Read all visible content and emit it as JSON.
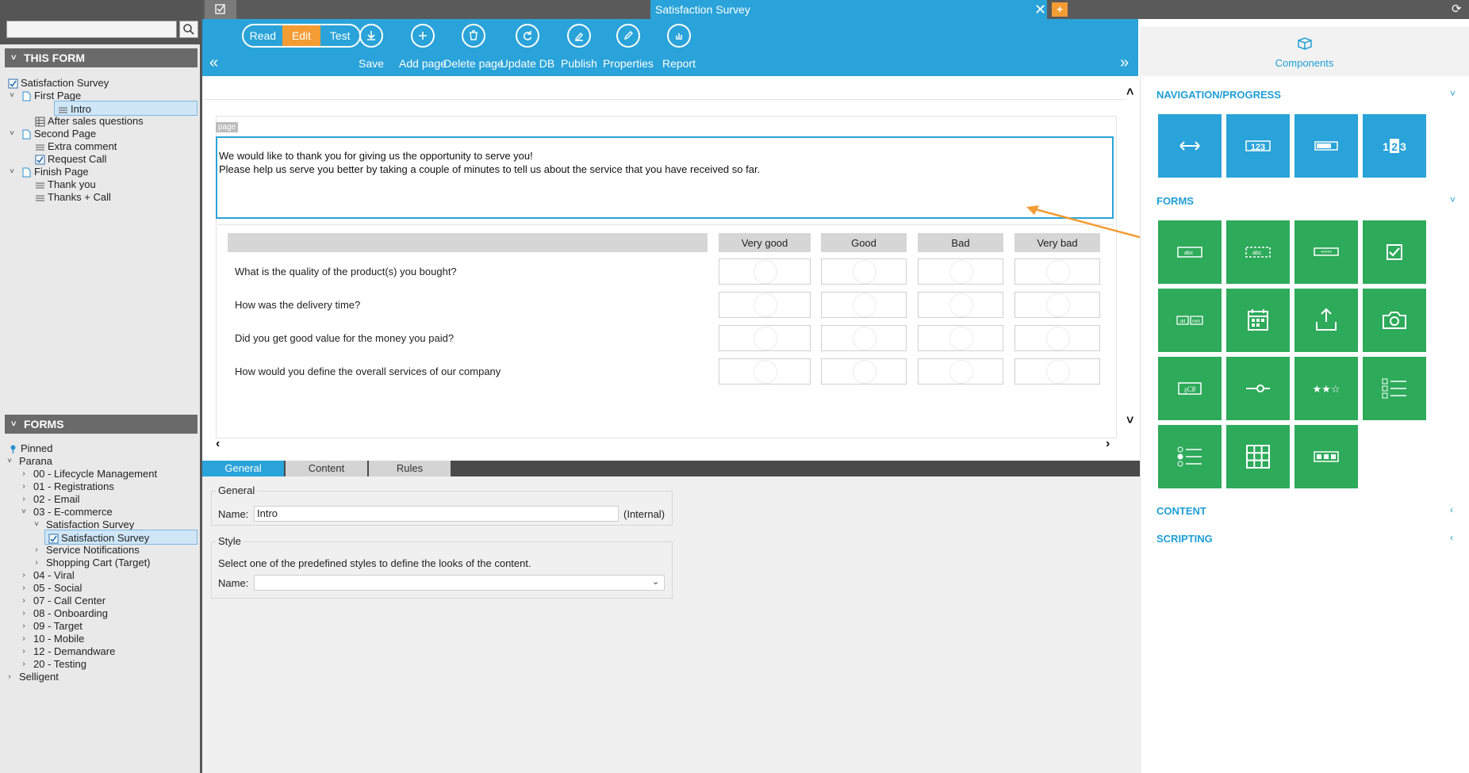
{
  "tabs": {
    "main_title": "Satisfaction Survey",
    "close_glyph": "✕",
    "add_glyph": "+"
  },
  "left": {
    "this_form_header": "THIS FORM",
    "this_form_tree": [
      {
        "label": "Satisfaction Survey",
        "icon": "check-icon"
      },
      {
        "label": "First Page",
        "icon": "page-icon"
      },
      {
        "label": "Intro",
        "icon": "lines-icon"
      },
      {
        "label": "After sales questions",
        "icon": "grid-icon"
      },
      {
        "label": "Second Page",
        "icon": "page-icon"
      },
      {
        "label": "Extra comment",
        "icon": "lines-icon"
      },
      {
        "label": "Request Call",
        "icon": "check-icon"
      },
      {
        "label": "Finish Page",
        "icon": "page-icon"
      },
      {
        "label": "Thank you",
        "icon": "lines-icon"
      },
      {
        "label": "Thanks + Call",
        "icon": "lines-icon"
      }
    ],
    "forms_header": "FORMS",
    "forms_tree": [
      {
        "label": "Pinned",
        "icon": "pin-icon"
      },
      {
        "label": "Parana"
      },
      {
        "label": "00 - Lifecycle Management"
      },
      {
        "label": "01 - Registrations"
      },
      {
        "label": "02 - Email"
      },
      {
        "label": "03 - E-commerce"
      },
      {
        "label": "Satisfaction Survey"
      },
      {
        "label": "Satisfaction Survey",
        "icon": "check-icon"
      },
      {
        "label": "Service Notifications"
      },
      {
        "label": "Shopping Cart (Target)"
      },
      {
        "label": "04 - Viral"
      },
      {
        "label": "05 - Social"
      },
      {
        "label": "07 - Call Center"
      },
      {
        "label": "08 - Onboarding"
      },
      {
        "label": "09 - Target"
      },
      {
        "label": "10 - Mobile"
      },
      {
        "label": "12 - Demandware"
      },
      {
        "label": "20 - Testing"
      },
      {
        "label": "Selligent"
      }
    ]
  },
  "toolbar": {
    "modes": [
      "Read",
      "Edit",
      "Test"
    ],
    "active_mode": "Edit",
    "tools": [
      {
        "label": "Save",
        "icon": "save-icon"
      },
      {
        "label": "Add page",
        "icon": "add-page-icon"
      },
      {
        "label": "Delete page",
        "icon": "trash-icon"
      },
      {
        "label": "Update DB",
        "icon": "refresh-icon"
      },
      {
        "label": "Publish",
        "icon": "publish-icon"
      },
      {
        "label": "Properties",
        "icon": "pencil-icon"
      },
      {
        "label": "Report",
        "icon": "report-icon"
      }
    ],
    "collapse_left": "«",
    "collapse_right": "»"
  },
  "canvas": {
    "page_tag": "page",
    "intro_text": "We would like to thank you for giving us the opportunity to serve you!\nPlease help us serve you better by taking a couple of minutes to tell us about the service that you have received so far.",
    "matrix_columns": [
      "Very good",
      "Good",
      "Bad",
      "Very bad"
    ],
    "matrix_questions": [
      "What is the quality of the product(s) you bought?",
      "How was the delivery time?",
      "Did you get good value for the money you paid?",
      "How would you define the overall services of our company"
    ]
  },
  "properties": {
    "tabs": [
      "General",
      "Content",
      "Rules"
    ],
    "active_tab": "General",
    "general_legend": "General",
    "name_label": "Name:",
    "name_value": "Intro",
    "internal_label": "(Internal)",
    "style_legend": "Style",
    "style_hint": "Select one of the predefined styles to define the looks of the content.",
    "style_name_label": "Name:",
    "style_name_value": ""
  },
  "components": {
    "tab_label": "Components",
    "sections": {
      "navigation": "NAVIGATION/PROGRESS",
      "forms": "FORMS",
      "content": "CONTENT",
      "scripting": "SCRIPTING"
    },
    "navigation_tiles": [
      "nav-arrows-icon",
      "step-numbers-icon",
      "progress-bar-icon",
      "page-number-icon"
    ],
    "form_tiles": [
      "textbox-icon",
      "masked-textbox-icon",
      "password-field-icon",
      "checkbox-icon",
      "date-fields-icon",
      "calendar-icon",
      "upload-icon",
      "camera-icon",
      "captcha-icon",
      "slider-icon",
      "rating-stars-icon",
      "checklist-icon",
      "radio-list-icon",
      "grid-matrix-icon",
      "segmented-choice-icon"
    ],
    "colors": {
      "navigation": "#29a3d9",
      "forms": "#2daa5a",
      "accent": "#f39c34"
    }
  }
}
